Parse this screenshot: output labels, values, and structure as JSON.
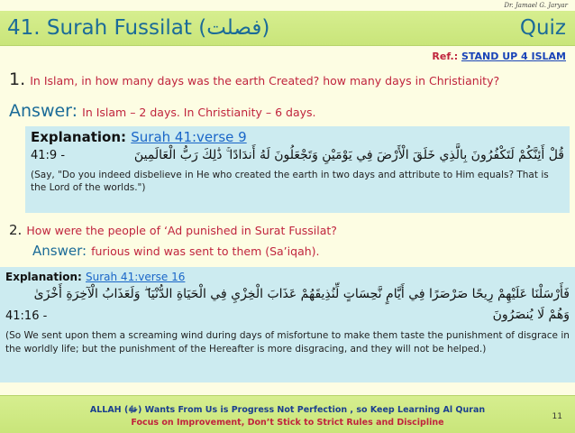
{
  "author": "Dr. Jamael G. Jaryar",
  "header": {
    "title": "41. Surah Fussilat (فصلت)",
    "right_label": "Quiz"
  },
  "reference": {
    "prefix": "Ref.: ",
    "link": "STAND UP 4 ISLAM"
  },
  "question1": {
    "number": "1.",
    "text": "In Islam, in how many days was the earth Created? how many days in Christianity?",
    "answer_label": "Answer:",
    "answer_text": "In Islam – 2 days. In Christianity – 6 days."
  },
  "explanation1": {
    "label": "Explanation: ",
    "link": "Surah 41:verse 9",
    "arabic": "قُلْ أَئِنَّكُمْ لَتَكْفُرُونَ بِالَّذِي خَلَقَ الْأَرْضَ فِي يَوْمَيْنِ وَتَجْعَلُونَ لَهُ أَندَادًا ۚ ذَٰلِكَ رَبُّ الْعَالَمِينَ",
    "verse_ref": "41:9 -",
    "translation": "(Say, \"Do you indeed disbelieve in He who created the earth in two days and attribute to Him equals? That is the Lord of the worlds.\")"
  },
  "question2": {
    "number": "2.",
    "text": "How were the people of ‘Ad punished in Surat Fussilat?",
    "answer_label": "Answer:",
    "answer_text": "furious wind was sent to them (Sa’iqah)."
  },
  "explanation2": {
    "label": "Explanation: ",
    "link": "Surah 41:verse 16",
    "arabic_line1": "فَأَرْسَلْنَا عَلَيْهِمْ رِيحًا صَرْصَرًا فِي أَيَّامٍ نَّحِسَاتٍ لِّنُذِيقَهُمْ عَذَابَ الْخِزْيِ فِي الْحَيَاةِ الدُّنْيَا ۖ وَلَعَذَابُ الْآخِرَةِ أَخْزَىٰ",
    "arabic_line2": "وَهُمْ لَا يُنصَرُونَ",
    "verse_ref": "41:16 -",
    "translation": "(So We sent upon them a screaming wind during days of misfortune to make them taste the punishment of disgrace in the worldly life; but the punishment of the Hereafter is more disgracing, and they will not be helped.)"
  },
  "footer": {
    "line1": "ALLAH (ﷻ) Wants From Us is Progress Not Perfection , so Keep Learning Al Quran",
    "line2": "Focus on Improvement, Don’t Stick to Strict Rules and Discipline",
    "page_number": "11"
  }
}
